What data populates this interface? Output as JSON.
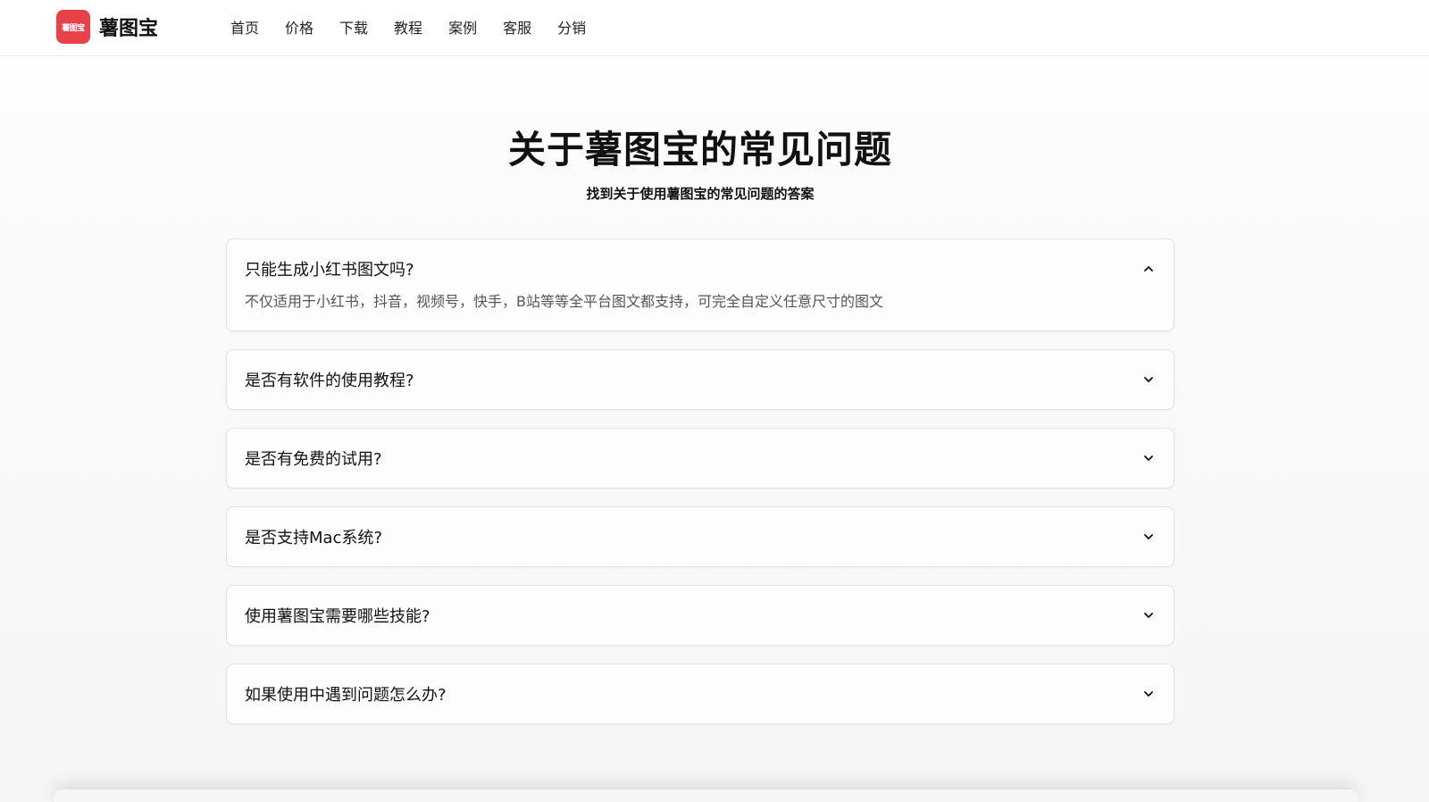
{
  "brand": {
    "logo_text": "薯图宝",
    "name": "薯图宝",
    "accent_color": "#e8414a"
  },
  "nav": [
    "首页",
    "价格",
    "下载",
    "教程",
    "案例",
    "客服",
    "分销"
  ],
  "hero": {
    "title": "关于薯图宝的常见问题",
    "subtitle": "找到关于使用薯图宝的常见问题的答案"
  },
  "faq": [
    {
      "question": "只能生成小红书图文吗?",
      "answer": "不仅适用于小红书，抖音，视频号，快手，B站等等全平台图文都支持，可完全自定义任意尺寸的图文",
      "expanded": true,
      "icon": "chevron-up-icon"
    },
    {
      "question": "是否有软件的使用教程?",
      "expanded": false,
      "icon": "chevron-down-icon"
    },
    {
      "question": "是否有免费的试用?",
      "expanded": false,
      "icon": "chevron-down-icon"
    },
    {
      "question": "是否支持Mac系统?",
      "expanded": false,
      "icon": "chevron-down-icon"
    },
    {
      "question": "使用薯图宝需要哪些技能?",
      "expanded": false,
      "icon": "chevron-down-icon"
    },
    {
      "question": "如果使用中遇到问题怎么办?",
      "expanded": false,
      "icon": "chevron-down-icon"
    }
  ]
}
